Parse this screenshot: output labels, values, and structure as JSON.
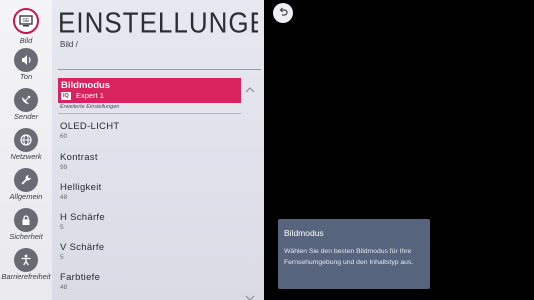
{
  "sidebar": {
    "items": [
      {
        "id": "bild",
        "label": "Bild",
        "icon": "picture-icon",
        "active": true
      },
      {
        "id": "ton",
        "label": "Ton",
        "icon": "speaker-icon",
        "active": false
      },
      {
        "id": "sender",
        "label": "Sender",
        "icon": "satellite-dish-icon",
        "active": false
      },
      {
        "id": "netzwerk",
        "label": "Netzwerk",
        "icon": "globe-icon",
        "active": false
      },
      {
        "id": "allgemein",
        "label": "Allgemein",
        "icon": "wrench-icon",
        "active": false
      },
      {
        "id": "sicherheit",
        "label": "Sicherheit",
        "icon": "lock-icon",
        "active": false
      },
      {
        "id": "barrierefreiheit",
        "label": "Barrierefreiheit",
        "icon": "accessibility-icon",
        "active": false
      }
    ]
  },
  "panel": {
    "title": "EINSTELLUNGEN FÜ...",
    "breadcrumb": "Bild /",
    "selected": {
      "label": "Bildmodus",
      "badge": "IQ",
      "value": "Expert 1"
    },
    "subheading": "Erweiterte Einstellungen",
    "rows": [
      {
        "label": "OLED-LICHT",
        "value": "60"
      },
      {
        "label": "Kontrast",
        "value": "99"
      },
      {
        "label": "Helligkeit",
        "value": "48"
      },
      {
        "label": "H Schärfe",
        "value": "5"
      },
      {
        "label": "V Schärfe",
        "value": "5"
      },
      {
        "label": "Farbtiefe",
        "value": "48"
      }
    ]
  },
  "info": {
    "title": "Bildmodus",
    "text": "Wählen Sie den besten Bildmodus für Ihre Fernsehumgebung und den Inhaltstyp aus."
  },
  "colors": {
    "accent": "#d8235f",
    "info_bg": "#57647e",
    "panel_bg": "#e1e2ea"
  }
}
